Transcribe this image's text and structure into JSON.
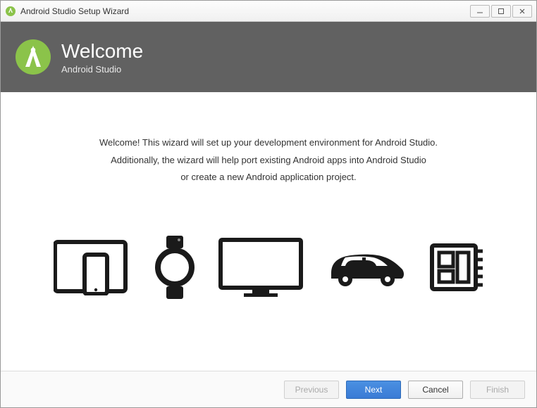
{
  "window": {
    "title": "Android Studio Setup Wizard"
  },
  "banner": {
    "title": "Welcome",
    "subtitle": "Android Studio"
  },
  "content": {
    "line1": "Welcome! This wizard will set up your development environment for Android Studio.",
    "line2": "Additionally, the wizard will help port existing Android apps into Android Studio",
    "line3": "or create a new Android application project."
  },
  "buttons": {
    "previous": "Previous",
    "next": "Next",
    "cancel": "Cancel",
    "finish": "Finish"
  },
  "colors": {
    "banner_bg": "#616161",
    "logo_green": "#8BC34A",
    "primary_btn": "#3a7bd5"
  }
}
